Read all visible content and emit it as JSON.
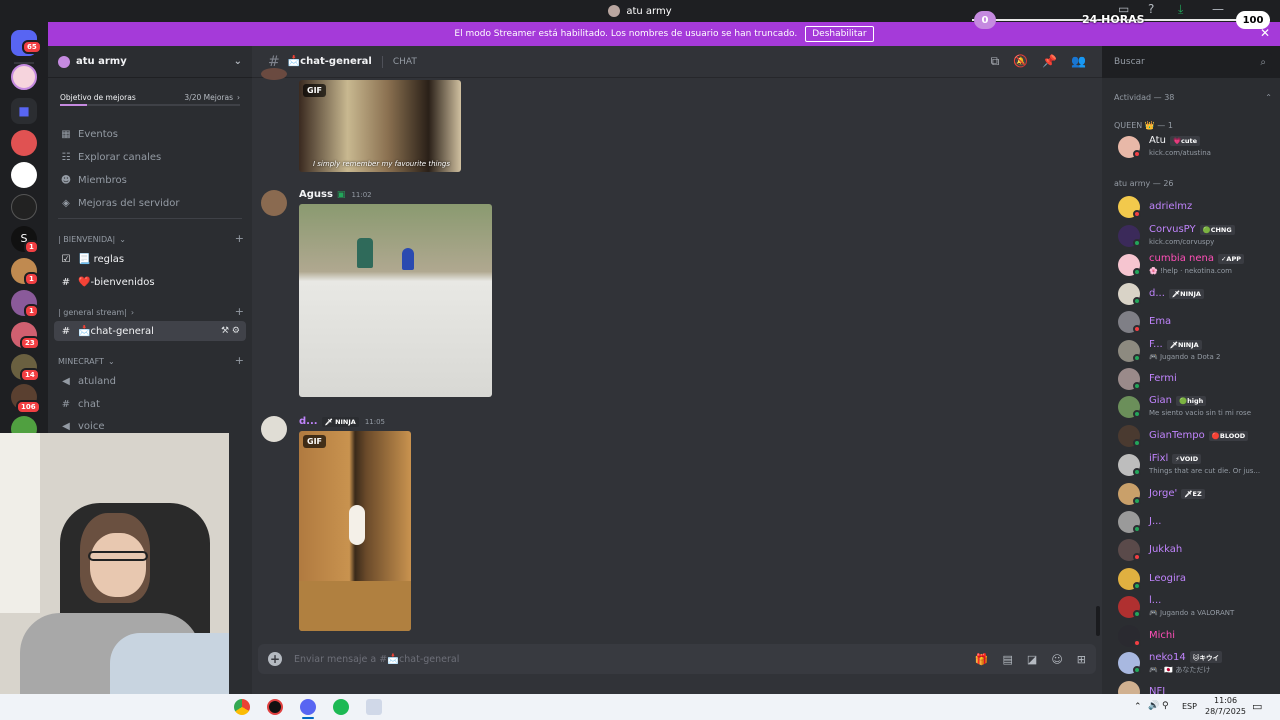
{
  "window": {
    "server_name": "atu army"
  },
  "overlay": {
    "left_value": "0",
    "right_value": "100",
    "label": "24 HORAS"
  },
  "banner": {
    "text": "El modo Streamer está habilitado. Los nombres de usuario se han truncado.",
    "button": "Deshabilitar"
  },
  "guild_badges": [
    "65",
    "1",
    "1",
    "1",
    "23",
    "14",
    "106"
  ],
  "sidebar": {
    "server": "atu army",
    "boost_goal": "Objetivo de mejoras",
    "boost_count": "3/20 Mejoras",
    "boost_progress": 0.15,
    "nav": [
      {
        "icon": "calendar-icon",
        "label": "Eventos"
      },
      {
        "icon": "compass-icon",
        "label": "Explorar canales"
      },
      {
        "icon": "members-icon",
        "label": "Miembros"
      },
      {
        "icon": "boost-icon",
        "label": "Mejoras del servidor"
      }
    ],
    "cat1": "| BIENVENIDA|",
    "cat1_channels": [
      "📃 reglas",
      "❤️-bienvenidos"
    ],
    "cat2": "| general stream|",
    "active_channel": "📩chat-general",
    "cat3": "MINECRAFT",
    "cat3_channels": [
      "atuland",
      "chat",
      "voice"
    ]
  },
  "chat": {
    "channel": "📩chat-general",
    "channel_type": "CHAT",
    "search_placeholder": "Buscar",
    "gif_label": "GIF",
    "gif1_caption": "I simply remember my favourite things",
    "messages": [
      {
        "author": "Aguss",
        "tag": "",
        "time": "11:02"
      },
      {
        "author": "d...",
        "tag": "🗡 NINJA",
        "time": "11:05"
      }
    ],
    "composer_placeholder": "Enviar mensaje a #📩chat-general"
  },
  "members": {
    "activity": "Actividad — 38",
    "queen_header": "QUEEN 👑 — 1",
    "army_header": "atu army — 26",
    "list": [
      {
        "name": "Atu",
        "tag": "💗cute",
        "sub": "kick.com/atustina",
        "color": "#f2f3f5",
        "status": "#f23f43",
        "avatar": "#e8b8a8"
      },
      {
        "name": "adrielmz",
        "tag": "",
        "sub": "",
        "color": "#c084fc",
        "status": "#f23f43",
        "avatar": "#f2c94c"
      },
      {
        "name": "CorvusPY",
        "tag": "🟢CHNG",
        "sub": "kick.com/corvuspy",
        "color": "#c084fc",
        "status": "#23a55a",
        "avatar": "#3b2a5a"
      },
      {
        "name": "cumbia nena",
        "tag": "✓APP",
        "sub": "🌸 !help · nekotina.com",
        "color": "#ff4fb8",
        "status": "#23a55a",
        "avatar": "#f6c5d0"
      },
      {
        "name": "d...",
        "tag": "🗡NINJA",
        "sub": "",
        "color": "#c084fc",
        "status": "#23a55a",
        "avatar": "#d9d3c7"
      },
      {
        "name": "Ema",
        "tag": "",
        "sub": "",
        "color": "#c084fc",
        "status": "#f23f43",
        "avatar": "#7f7f86"
      },
      {
        "name": "F...",
        "tag": "🗡NINJA",
        "sub": "🎮 Jugando a Dota 2",
        "color": "#c084fc",
        "status": "#23a55a",
        "avatar": "#8d8a80"
      },
      {
        "name": "Fermi",
        "tag": "",
        "sub": "",
        "color": "#c084fc",
        "status": "#23a55a",
        "avatar": "#9a8a8a"
      },
      {
        "name": "Gian",
        "tag": "🟢high",
        "sub": "Me siento vacio sin ti mi rose",
        "color": "#c084fc",
        "status": "#23a55a",
        "avatar": "#6b8f5a"
      },
      {
        "name": "GianTempo",
        "tag": "🔴BLOOD",
        "sub": "",
        "color": "#c084fc",
        "status": "#23a55a",
        "avatar": "#4a3a30"
      },
      {
        "name": "iFixl",
        "tag": "⚡VOID",
        "sub": "Things that are cut die. Or jus...",
        "color": "#c084fc",
        "status": "#23a55a",
        "avatar": "#bdbdbd"
      },
      {
        "name": "Jorge'",
        "tag": "🗡EZ",
        "sub": "",
        "color": "#c084fc",
        "status": "#23a55a",
        "avatar": "#c9a06a"
      },
      {
        "name": "J...",
        "tag": "",
        "sub": "",
        "color": "#c084fc",
        "status": "#23a55a",
        "avatar": "#9a9a9a"
      },
      {
        "name": "Jukkah",
        "tag": "",
        "sub": "",
        "color": "#c084fc",
        "status": "#f23f43",
        "avatar": "#5a4a4a"
      },
      {
        "name": "Leogira",
        "tag": "",
        "sub": "",
        "color": "#c084fc",
        "status": "#23a55a",
        "avatar": "#e0b040"
      },
      {
        "name": "l...",
        "tag": "",
        "sub": "🎮 Jugando a VALORANT",
        "color": "#c084fc",
        "status": "#23a55a",
        "avatar": "#b03030"
      },
      {
        "name": "Michi",
        "tag": "",
        "sub": "",
        "color": "#ff4fb8",
        "status": "#f23f43",
        "avatar": "#2a2a30"
      },
      {
        "name": "neko14",
        "tag": "🐱キウイ",
        "sub": "🎮 · 🇯🇵 あなただけ",
        "color": "#c084fc",
        "status": "#23a55a",
        "avatar": "#a8b8e0"
      },
      {
        "name": "NFI",
        "tag": "",
        "sub": "",
        "color": "#c084fc",
        "status": "#23a55a",
        "avatar": "#d0b090"
      }
    ]
  },
  "taskbar": {
    "lang": "ESP",
    "time": "11:06",
    "date": "28/7/2025"
  }
}
